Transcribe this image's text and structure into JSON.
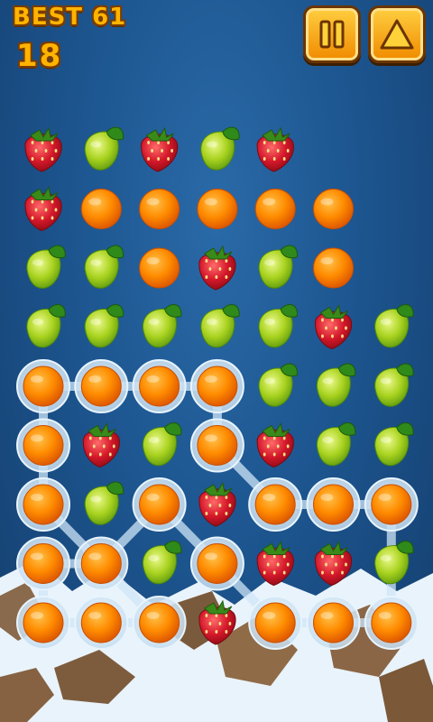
{
  "hud": {
    "best_label": "BEST 61",
    "score": "18"
  },
  "buttons": {
    "pause_icon": "pause-icon",
    "up_icon": "up-arrow-icon"
  },
  "grid": {
    "cols": 7,
    "rows": 9,
    "cells": [
      [
        "strawberry",
        "lime",
        "strawberry",
        "lime",
        "strawberry",
        "",
        ""
      ],
      [
        "strawberry",
        "orange",
        "orange",
        "orange",
        "orange",
        "orange",
        ""
      ],
      [
        "lime",
        "lime",
        "orange",
        "strawberry",
        "lime",
        "orange",
        ""
      ],
      [
        "lime",
        "lime",
        "lime",
        "lime",
        "lime",
        "strawberry",
        "lime"
      ],
      [
        "orange",
        "orange",
        "orange",
        "orange",
        "lime",
        "lime",
        "lime"
      ],
      [
        "orange",
        "strawberry",
        "lime",
        "orange",
        "strawberry",
        "lime",
        "lime"
      ],
      [
        "orange",
        "lime",
        "orange",
        "strawberry",
        "orange",
        "orange",
        "orange"
      ],
      [
        "orange",
        "orange",
        "lime",
        "orange",
        "strawberry",
        "strawberry",
        "lime"
      ],
      [
        "orange",
        "orange",
        "orange",
        "strawberry",
        "orange",
        "orange",
        "orange"
      ]
    ],
    "selected": [
      [
        4,
        0
      ],
      [
        4,
        1
      ],
      [
        4,
        2
      ],
      [
        4,
        3
      ],
      [
        5,
        0
      ],
      [
        5,
        3
      ],
      [
        6,
        0
      ],
      [
        6,
        2
      ],
      [
        6,
        4
      ],
      [
        6,
        5
      ],
      [
        6,
        6
      ],
      [
        7,
        0
      ],
      [
        7,
        1
      ],
      [
        7,
        3
      ],
      [
        8,
        0
      ],
      [
        8,
        1
      ],
      [
        8,
        2
      ],
      [
        8,
        4
      ],
      [
        8,
        5
      ],
      [
        8,
        6
      ]
    ],
    "path": [
      [
        4,
        0
      ],
      [
        4,
        1
      ],
      [
        4,
        2
      ],
      [
        4,
        3
      ],
      [
        5,
        3
      ],
      [
        6,
        4
      ],
      [
        6,
        5
      ],
      [
        6,
        6
      ],
      [
        8,
        6
      ],
      [
        8,
        5
      ],
      [
        8,
        4
      ],
      [
        7,
        3
      ],
      [
        6,
        2
      ],
      [
        7,
        1
      ],
      [
        7,
        0
      ],
      [
        8,
        0
      ],
      [
        8,
        1
      ],
      [
        8,
        2
      ],
      [
        6,
        0
      ],
      [
        5,
        0
      ],
      [
        4,
        0
      ]
    ]
  },
  "colors": {
    "orange": "#ff8c00",
    "lime": "#9ccc1a",
    "strawberry": "#d4182a",
    "selection": "#cfe6f7"
  }
}
